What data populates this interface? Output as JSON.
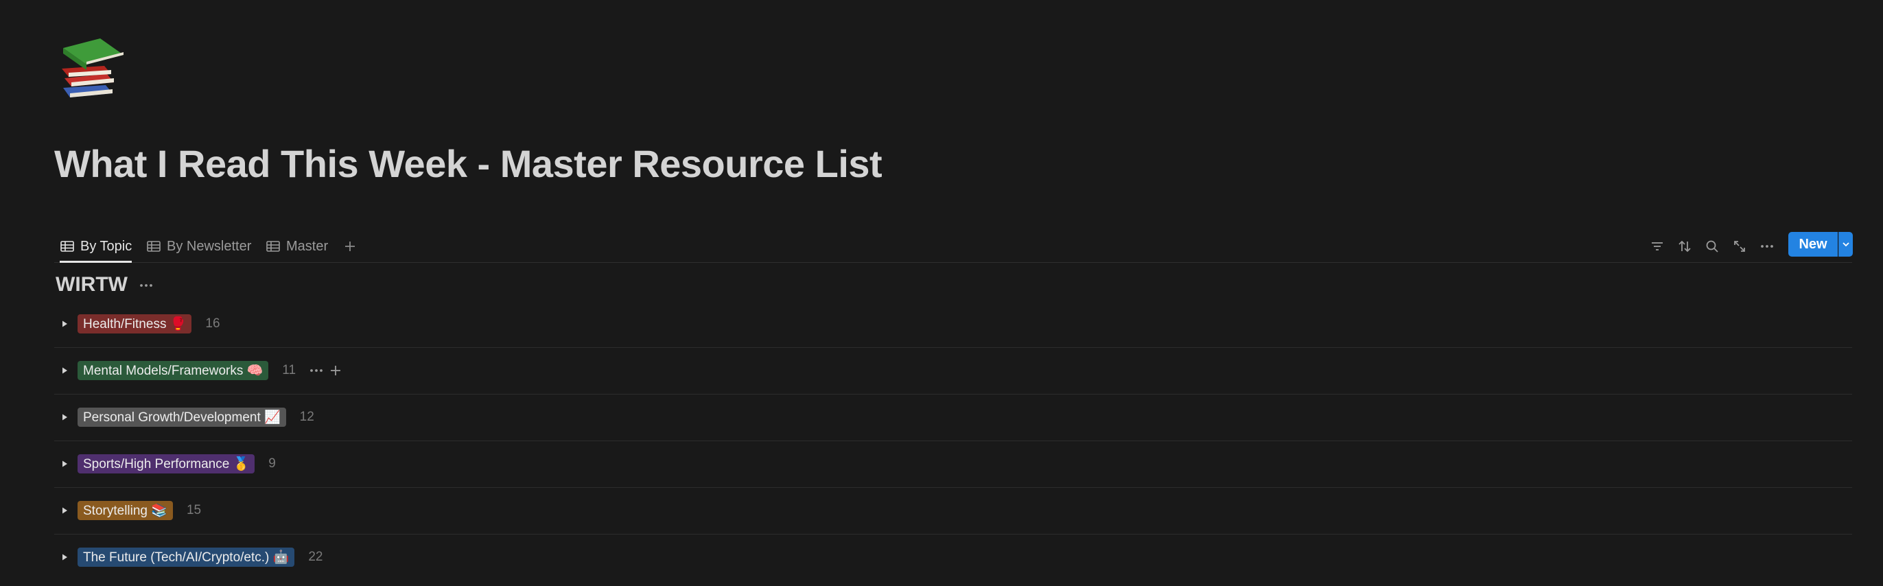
{
  "page": {
    "icon": "books-emoji",
    "title": "What I Read This Week - Master Resource List"
  },
  "views": {
    "tabs": [
      {
        "label": "By Topic",
        "icon": "table-icon",
        "active": true
      },
      {
        "label": "By Newsletter",
        "icon": "table-icon",
        "active": false
      },
      {
        "label": "Master",
        "icon": "table-icon",
        "active": false
      }
    ],
    "add_view_icon": "plus-icon"
  },
  "toolbar": {
    "icons": [
      "filter-icon",
      "sort-icon",
      "search-icon",
      "expand-icon",
      "more-icon"
    ],
    "new_label": "New",
    "accent": "#2383e2"
  },
  "section": {
    "title": "WIRTW"
  },
  "groups": [
    {
      "label": "Health/Fitness 🥊",
      "count": "16",
      "color": "#7a2d2b"
    },
    {
      "label": "Mental Models/Frameworks 🧠",
      "count": "11",
      "color": "#2b5a3a",
      "hovered": true
    },
    {
      "label": "Personal Growth/Development 📈",
      "count": "12",
      "color": "#555555"
    },
    {
      "label": "Sports/High Performance 🥇",
      "count": "9",
      "color": "#4f2f6e"
    },
    {
      "label": "Storytelling 📚",
      "count": "15",
      "color": "#8a5a1f"
    },
    {
      "label": "The Future (Tech/AI/Crypto/etc.) 🤖",
      "count": "22",
      "color": "#264a72"
    }
  ]
}
